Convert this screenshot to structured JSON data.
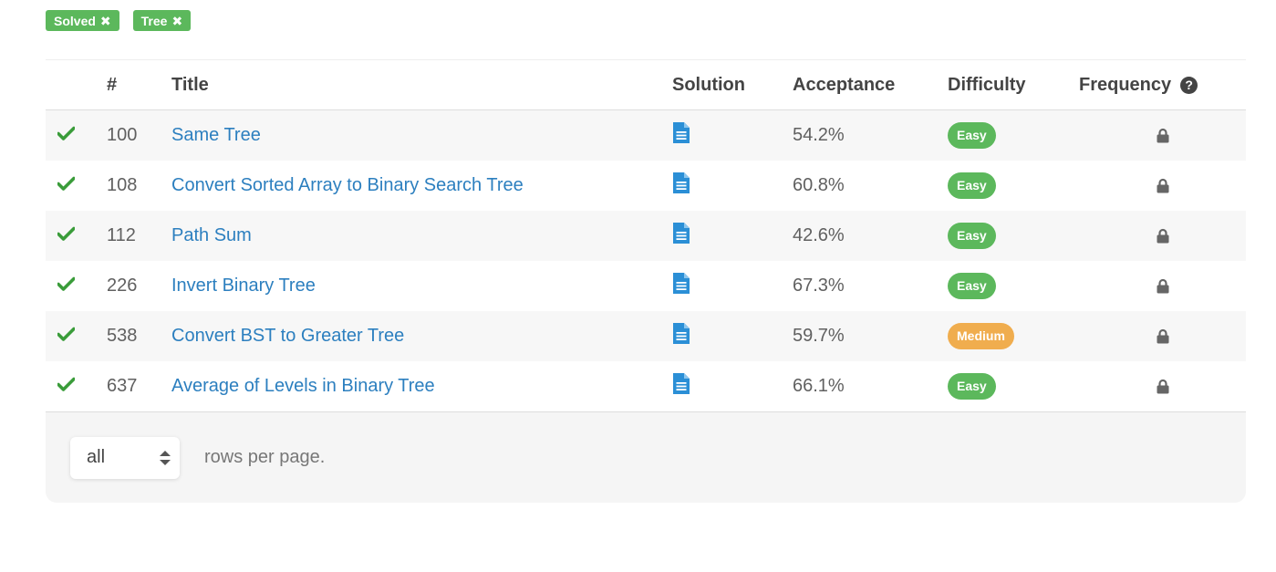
{
  "filters": [
    {
      "label": "Solved",
      "remove": "✖"
    },
    {
      "label": "Tree",
      "remove": "✖"
    }
  ],
  "table": {
    "headers": {
      "num": "#",
      "title": "Title",
      "solution": "Solution",
      "acceptance": "Acceptance",
      "difficulty": "Difficulty",
      "frequency": "Frequency",
      "frequency_help": "?"
    },
    "rows": [
      {
        "status_icon": "check-icon",
        "num": "100",
        "title": "Same Tree",
        "solution_icon": "document-icon",
        "acceptance": "54.2%",
        "difficulty": "Easy",
        "frequency_icon": "lock-icon"
      },
      {
        "status_icon": "check-icon",
        "num": "108",
        "title": "Convert Sorted Array to Binary Search Tree",
        "solution_icon": "document-icon",
        "acceptance": "60.8%",
        "difficulty": "Easy",
        "frequency_icon": "lock-icon"
      },
      {
        "status_icon": "check-icon",
        "num": "112",
        "title": "Path Sum",
        "solution_icon": "document-icon",
        "acceptance": "42.6%",
        "difficulty": "Easy",
        "frequency_icon": "lock-icon"
      },
      {
        "status_icon": "check-icon",
        "num": "226",
        "title": "Invert Binary Tree",
        "solution_icon": "document-icon",
        "acceptance": "67.3%",
        "difficulty": "Easy",
        "frequency_icon": "lock-icon"
      },
      {
        "status_icon": "check-icon",
        "num": "538",
        "title": "Convert BST to Greater Tree",
        "solution_icon": "document-icon",
        "acceptance": "59.7%",
        "difficulty": "Medium",
        "frequency_icon": "lock-icon"
      },
      {
        "status_icon": "check-icon",
        "num": "637",
        "title": "Average of Levels in Binary Tree",
        "solution_icon": "document-icon",
        "acceptance": "66.1%",
        "difficulty": "Easy",
        "frequency_icon": "lock-icon"
      }
    ]
  },
  "pagination": {
    "rows_select_value": "all",
    "rows_per_page_text": "rows per page."
  },
  "colors": {
    "easy": "#5cb85c",
    "medium": "#f0ad4e",
    "link": "#2c7fbf",
    "check": "#3a9c3a",
    "doc": "#2b8fd6"
  }
}
